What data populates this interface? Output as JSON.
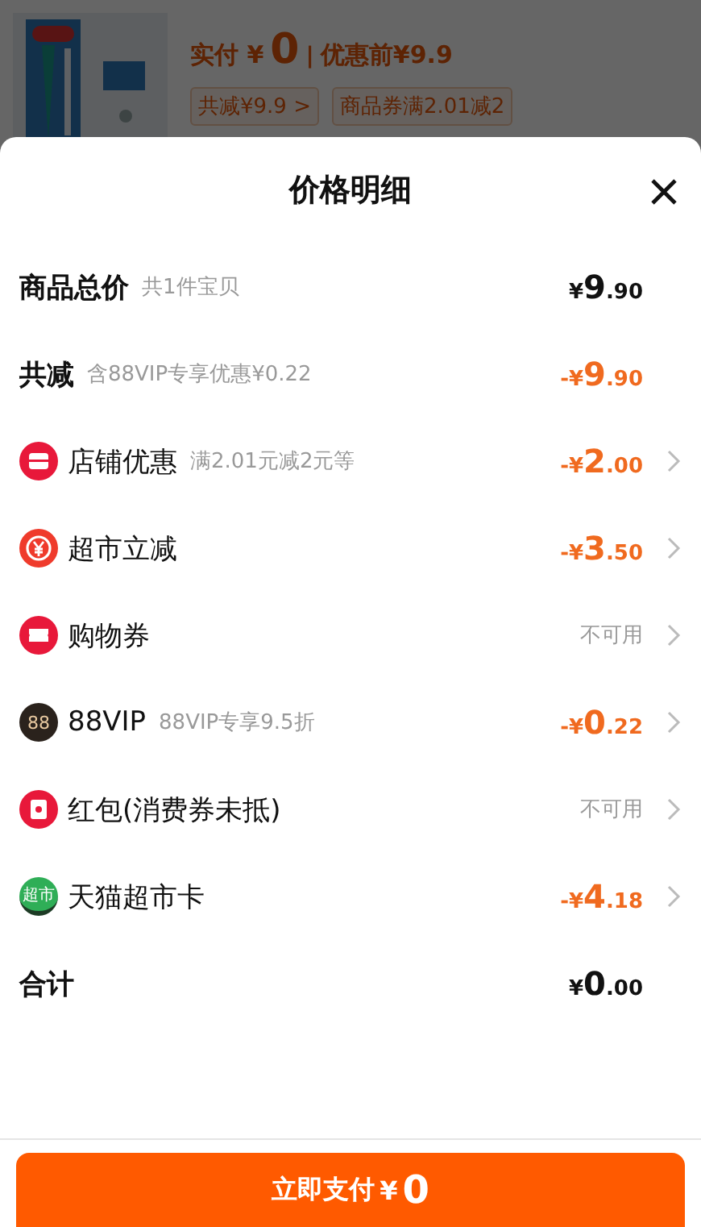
{
  "backdrop": {
    "paid_label": "实付 ¥",
    "paid_amount": "0",
    "separator": "|",
    "original_price": "优惠前¥9.9",
    "chips": [
      "共减¥9.9 >",
      "商品券满2.01减2"
    ]
  },
  "sheet": {
    "title": "价格明细",
    "rows": [
      {
        "kind": "summary",
        "label": "商品总价",
        "note": "共1件宝贝",
        "prefix": "¥",
        "main": "9",
        "decimals": ".90"
      },
      {
        "kind": "summary_discount",
        "label": "共减",
        "note": "含88VIP专享优惠¥0.22",
        "prefix": "-¥",
        "main": "9",
        "decimals": ".90"
      },
      {
        "kind": "discount",
        "label": "店铺优惠",
        "note": "满2.01元减2元等",
        "prefix": "-¥",
        "main": "2",
        "decimals": ".00"
      },
      {
        "kind": "discount",
        "label": "超市立减",
        "prefix": "-¥",
        "main": "3",
        "decimals": ".50"
      },
      {
        "kind": "unavailable",
        "label": "购物券",
        "status": "不可用"
      },
      {
        "kind": "discount",
        "badge": "88",
        "label": "88VIP",
        "note": "88VIP专享9.5折",
        "prefix": "-¥",
        "main": "0",
        "decimals": ".22"
      },
      {
        "kind": "unavailable",
        "label": "红包(消费券未抵)",
        "status": "不可用"
      },
      {
        "kind": "discount",
        "badge": "超市",
        "label": "天猫超市卡",
        "prefix": "-¥",
        "main": "4",
        "decimals": ".18"
      },
      {
        "kind": "summary",
        "label": "合计",
        "prefix": "¥",
        "main": "0",
        "decimals": ".00"
      }
    ]
  },
  "pay_button": {
    "label": "立即支付",
    "prefix": "¥",
    "amount": "0"
  }
}
